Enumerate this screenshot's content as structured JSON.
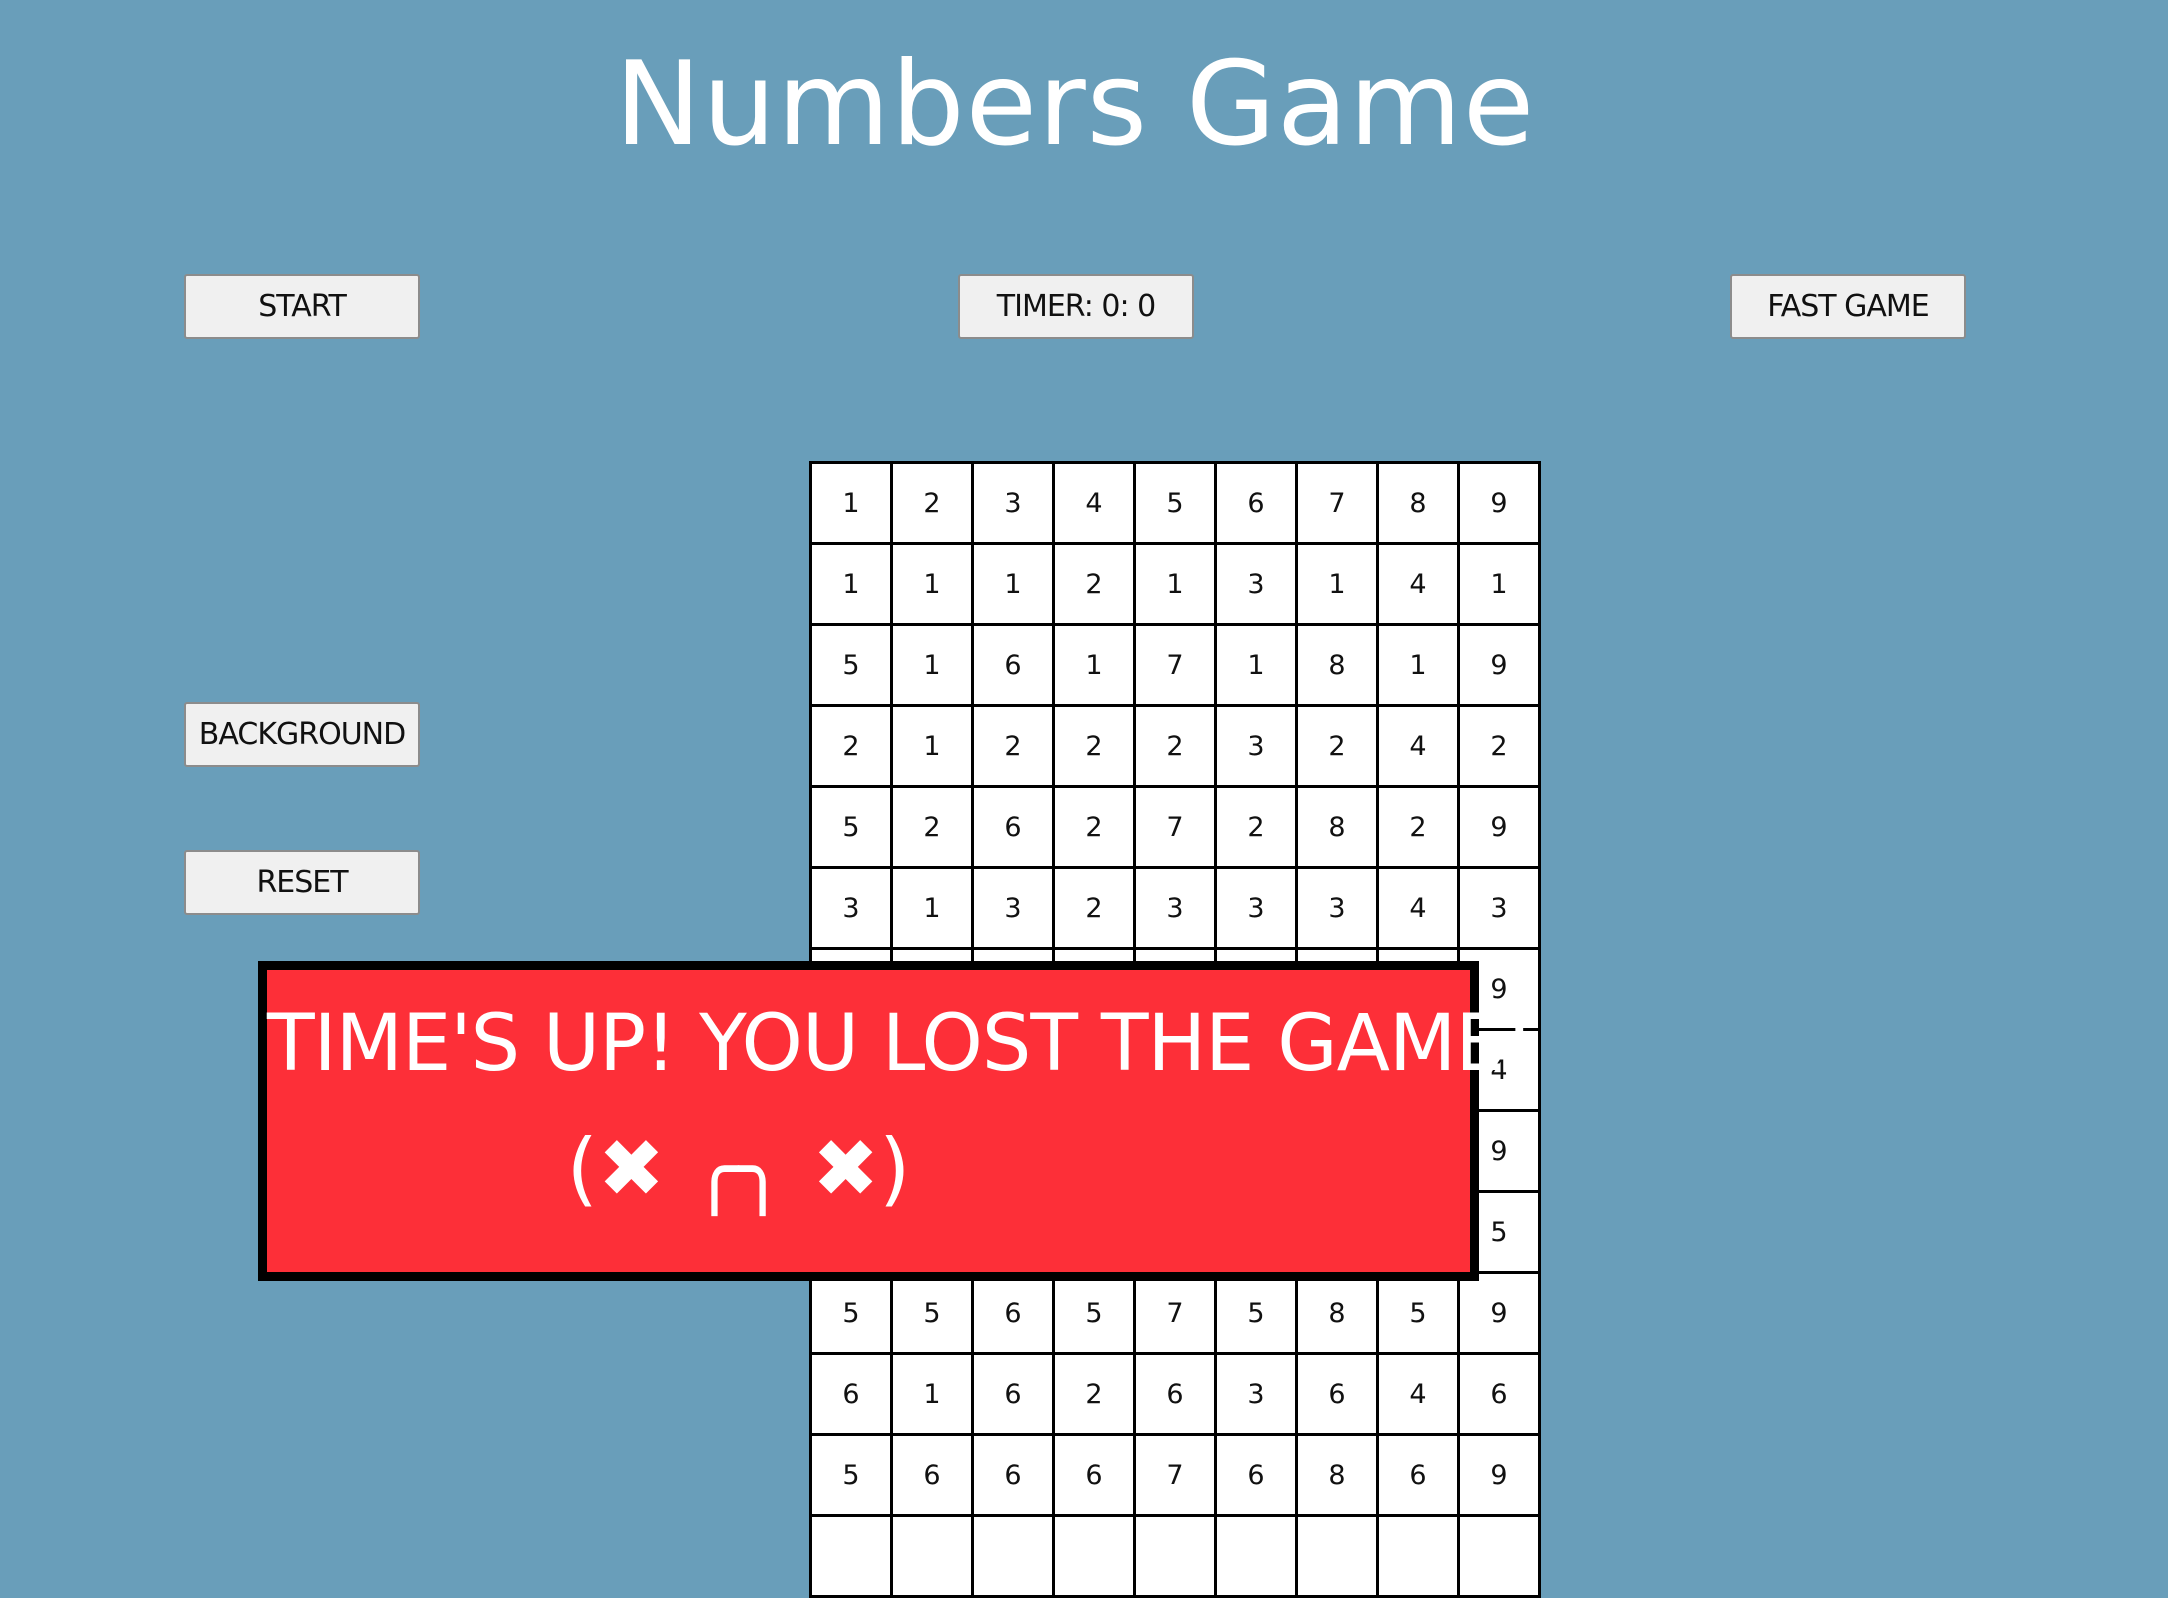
{
  "title": "Numbers Game",
  "buttons": {
    "start": "Start",
    "timer": "TIMER: 0: 0",
    "fast_game": "FAST GAME",
    "background": "BACKGROUND",
    "reset": "RESET"
  },
  "grid": {
    "rows": [
      [
        "1",
        "2",
        "3",
        "4",
        "5",
        "6",
        "7",
        "8",
        "9"
      ],
      [
        "1",
        "1",
        "1",
        "2",
        "1",
        "3",
        "1",
        "4",
        "1"
      ],
      [
        "5",
        "1",
        "6",
        "1",
        "7",
        "1",
        "8",
        "1",
        "9"
      ],
      [
        "2",
        "1",
        "2",
        "2",
        "2",
        "3",
        "2",
        "4",
        "2"
      ],
      [
        "5",
        "2",
        "6",
        "2",
        "7",
        "2",
        "8",
        "2",
        "9"
      ],
      [
        "3",
        "1",
        "3",
        "2",
        "3",
        "3",
        "3",
        "4",
        "3"
      ],
      [
        "",
        "",
        "",
        "",
        "",
        "",
        "",
        "",
        "9"
      ],
      [
        "",
        "",
        "",
        "",
        "",
        "",
        "",
        "",
        "4"
      ],
      [
        "",
        "",
        "",
        "",
        "",
        "",
        "",
        "",
        "9"
      ],
      [
        "",
        "",
        "",
        "",
        "",
        "",
        "",
        "",
        "5"
      ],
      [
        "5",
        "5",
        "6",
        "5",
        "7",
        "5",
        "8",
        "5",
        "9"
      ],
      [
        "6",
        "1",
        "6",
        "2",
        "6",
        "3",
        "6",
        "4",
        "6"
      ],
      [
        "5",
        "6",
        "6",
        "6",
        "7",
        "6",
        "8",
        "6",
        "9"
      ],
      [
        "",
        "",
        "",
        "",
        "",
        "",
        "",
        "",
        ""
      ]
    ]
  },
  "message": {
    "line1": "Time's up! You lost the game!",
    "line2": "(✖ ╭╮ ✖)"
  },
  "colors": {
    "background": "#699eba",
    "banner": "#fd2f38"
  }
}
